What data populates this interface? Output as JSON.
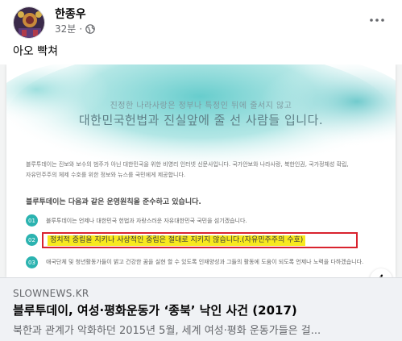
{
  "post": {
    "author": "한종우",
    "time": "32분",
    "separator": "·",
    "audience_icon": "globe-icon",
    "more_icon": "more-horizontal-icon",
    "text": "아오 빡쳐"
  },
  "preview": {
    "line1": "진정한 나라사랑은 정부나 특정인 뒤에 줄서지 않고",
    "line2": "대한민국헌법과 진실앞에 줄 선 사람들 입니다.",
    "intro_1": "블루투데이는 진보와 보수의 범주가 아닌 대한민국을 위한 비영리 인터넷 신문사입니다. 국가안보와 나라사랑, 북한인권, 국가정체성 확립,",
    "intro_2": "자유민주주의 체제 수호를 위한 정보와 뉴스를 국민에게 제공합니다.",
    "heading": "블루투데이는 다음과 같은 운영원칙을 준수하고 있습니다.",
    "principles": [
      {
        "num": "01",
        "text": "블루투데이는 언제나 대한민국 헌법과 자랑스러운 자유대한민국 국민을 섬기겠습니다."
      },
      {
        "num": "02",
        "text": "정치적 중립을 지키나 사상적인 중립은 절대로 지키지 않습니다.(자유민주주의 수호)"
      },
      {
        "num": "03",
        "text": "애국단체 및 청년활동가들이 밝고 건강한 꿈을 실현 할 수 있도록 인재양성과 그들의 활동에 도움이 되도록 언제나 노력을 다하겠습니다."
      }
    ],
    "info_icon": "info-icon",
    "colors": {
      "highlight": "#f7e91f",
      "box": "#d9232e",
      "teal": "#2bb3b0"
    }
  },
  "link": {
    "domain": "SLOWNEWS.KR",
    "title": "블루투데이, 여성·평화운동가 ‘종북’ 낙인 사건 (2017)",
    "description": "북한과 관계가 악화하던 2015년 5월, 세계 여성·평화 운동가들은 걸..."
  }
}
